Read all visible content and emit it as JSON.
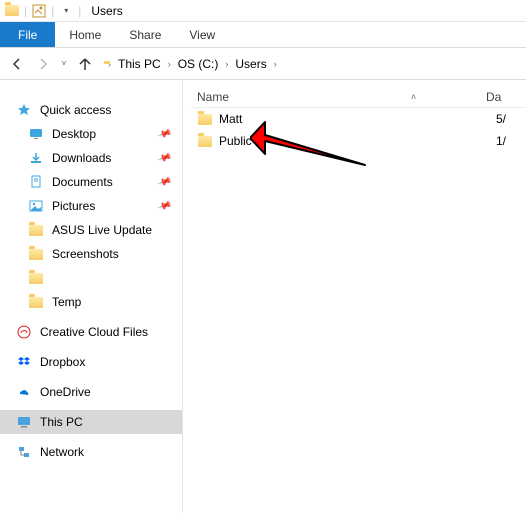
{
  "title": "Users",
  "ribbon": {
    "file": "File",
    "tabs": [
      "Home",
      "Share",
      "View"
    ]
  },
  "breadcrumb": {
    "segments": [
      "This PC",
      "OS (C:)",
      "Users"
    ]
  },
  "sidebar": {
    "quick_access": "Quick access",
    "items": [
      {
        "label": "Desktop",
        "pinned": true
      },
      {
        "label": "Downloads",
        "pinned": true
      },
      {
        "label": "Documents",
        "pinned": true
      },
      {
        "label": "Pictures",
        "pinned": true
      },
      {
        "label": "ASUS Live Update",
        "pinned": false
      },
      {
        "label": "Screenshots",
        "pinned": false
      },
      {
        "label": "",
        "pinned": false
      },
      {
        "label": "Temp",
        "pinned": false
      }
    ],
    "roots": [
      {
        "label": "Creative Cloud Files"
      },
      {
        "label": "Dropbox"
      },
      {
        "label": "OneDrive"
      },
      {
        "label": "This PC"
      },
      {
        "label": "Network"
      }
    ]
  },
  "columns": {
    "name": "Name",
    "date": "Da"
  },
  "files": [
    {
      "name": "Matt",
      "date": "5/"
    },
    {
      "name": "Public",
      "date": "1/"
    }
  ]
}
